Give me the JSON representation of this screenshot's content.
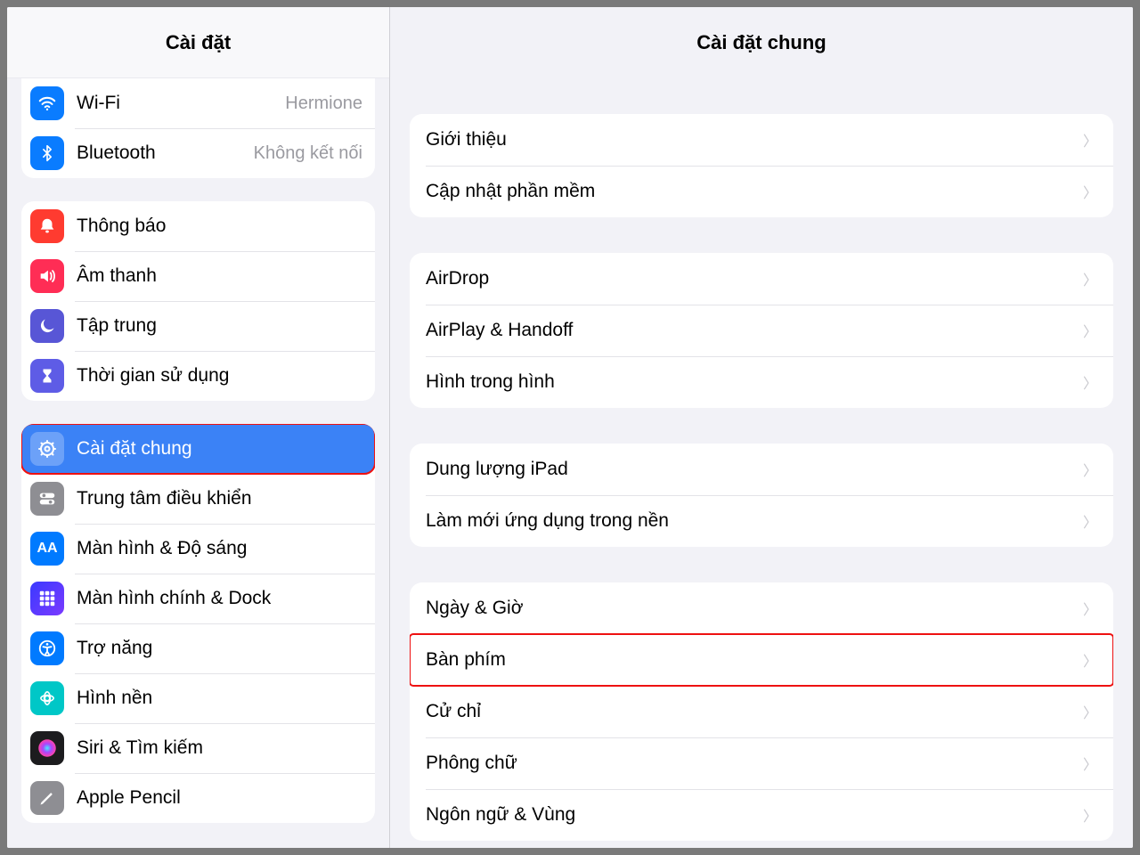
{
  "sidebar": {
    "title": "Cài đặt",
    "groups": [
      {
        "rows": [
          {
            "label": "Wi-Fi",
            "value": "Hermione",
            "icon": "wifi-icon",
            "bg": "bg-blue"
          },
          {
            "label": "Bluetooth",
            "value": "Không kết nối",
            "icon": "bluetooth-icon",
            "bg": "bg-blue"
          }
        ]
      },
      {
        "rows": [
          {
            "label": "Thông báo",
            "icon": "bell-icon",
            "bg": "bg-red"
          },
          {
            "label": "Âm thanh",
            "icon": "speaker-icon",
            "bg": "bg-pink"
          },
          {
            "label": "Tập trung",
            "icon": "moon-icon",
            "bg": "bg-indigo"
          },
          {
            "label": "Thời gian sử dụng",
            "icon": "hourglass-icon",
            "bg": "bg-indigo2"
          }
        ]
      },
      {
        "rows": [
          {
            "label": "Cài đặt chung",
            "icon": "gear-icon",
            "bg": "bg-gear-sel",
            "selected": true
          },
          {
            "label": "Trung tâm điều khiển",
            "icon": "toggles-icon",
            "bg": "bg-gray"
          },
          {
            "label": "Màn hình & Độ sáng",
            "icon": "aa-icon",
            "bg": "bg-blueA"
          },
          {
            "label": "Màn hình chính & Dock",
            "icon": "home-icon",
            "bg": "bg-home"
          },
          {
            "label": "Trợ năng",
            "icon": "accessibility-icon",
            "bg": "bg-blueA"
          },
          {
            "label": "Hình nền",
            "icon": "wallpaper-icon",
            "bg": "bg-cyan"
          },
          {
            "label": "Siri & Tìm kiếm",
            "icon": "siri-icon",
            "bg": "bg-black"
          },
          {
            "label": "Apple Pencil",
            "icon": "pencil-icon",
            "bg": "bg-gray2"
          }
        ]
      }
    ]
  },
  "detail": {
    "title": "Cài đặt chung",
    "groups": [
      {
        "rows": [
          {
            "label": "Giới thiệu"
          },
          {
            "label": "Cập nhật phần mềm"
          }
        ]
      },
      {
        "rows": [
          {
            "label": "AirDrop"
          },
          {
            "label": "AirPlay & Handoff"
          },
          {
            "label": "Hình trong hình"
          }
        ]
      },
      {
        "rows": [
          {
            "label": "Dung lượng iPad"
          },
          {
            "label": "Làm mới ứng dụng trong nền"
          }
        ]
      },
      {
        "rows": [
          {
            "label": "Ngày & Giờ"
          },
          {
            "label": "Bàn phím",
            "highlight": true
          },
          {
            "label": "Cử chỉ"
          },
          {
            "label": "Phông chữ"
          },
          {
            "label": "Ngôn ngữ & Vùng"
          }
        ]
      }
    ]
  },
  "highlight_color": "#ee1111"
}
